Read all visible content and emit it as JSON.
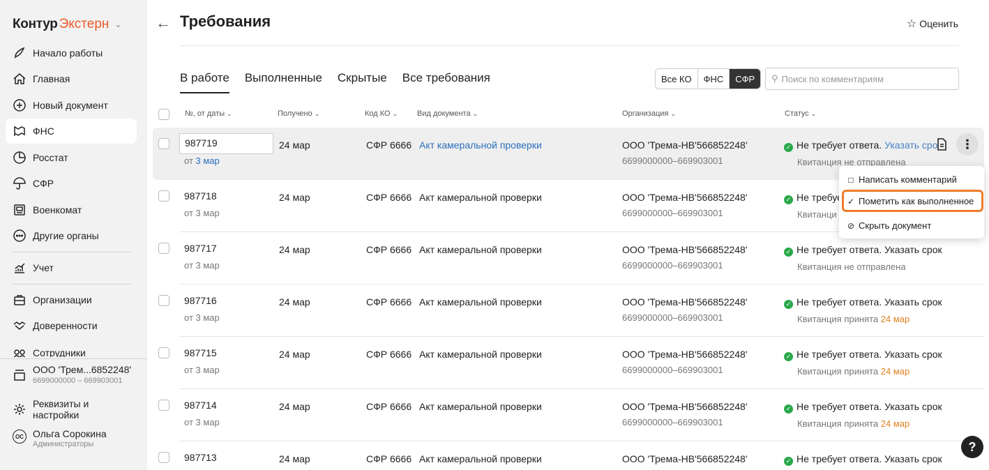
{
  "sidebar": {
    "brand": "Контур",
    "product": "Экстерн",
    "items": [
      {
        "label": "Начало работы",
        "icon": "rocket-icon"
      },
      {
        "label": "Главная",
        "icon": "home-icon"
      },
      {
        "label": "Новый документ",
        "icon": "plus-circle-icon"
      },
      {
        "label": "ФНС",
        "icon": "fns-icon"
      },
      {
        "label": "Росстат",
        "icon": "pie-chart-icon"
      },
      {
        "label": "СФР",
        "icon": "umbrella-icon"
      },
      {
        "label": "Военкомат",
        "icon": "military-icon"
      },
      {
        "label": "Другие органы",
        "icon": "more-circle-icon"
      },
      {
        "label": "Учет",
        "icon": "chart-growth-icon"
      },
      {
        "label": "Организации",
        "icon": "briefcase-icon"
      },
      {
        "label": "Доверенности",
        "icon": "handshake-icon"
      },
      {
        "label": "Сотрудники",
        "icon": "people-icon"
      }
    ],
    "org": {
      "name": "ООО 'Трем...6852248'",
      "inn": "6699000000 – 669903001"
    },
    "settings": "Реквизиты и настройки",
    "user": {
      "initials": "ОС",
      "name": "Ольга Сорокина",
      "role": "Администраторы"
    }
  },
  "header": {
    "title": "Требования",
    "rate": "Оценить"
  },
  "tabs": [
    "В работе",
    "Выполненные",
    "Скрытые",
    "Все требования"
  ],
  "filter": [
    "Все КО",
    "ФНС",
    "СФР"
  ],
  "search": {
    "placeholder": "Поиск по комментариям"
  },
  "columns": {
    "num": "№, от даты",
    "received": "Получено",
    "ko": "Код КО",
    "doctype": "Вид документа",
    "org": "Организация",
    "status": "Статус"
  },
  "rows": [
    {
      "num": "987719",
      "from_prefix": "от",
      "from_date": "3 мар",
      "received": "24 мар",
      "ko": "СФР 6666",
      "doctype": "Акт камеральной проверки",
      "org": "ООО 'Трема-НВ'566852248'",
      "inn": "6699000000–669903001",
      "status": "Не требует ответа.",
      "action": "Указать срок",
      "receipt": "Квитанция не отправлена",
      "receipt_date": ""
    },
    {
      "num": "987718",
      "from_prefix": "от",
      "from_date": "3 мар",
      "received": "24 мар",
      "ko": "СФР 6666",
      "doctype": "Акт камеральной проверки",
      "org": "ООО 'Трема-НВ'566852248'",
      "inn": "6699000000–669903001",
      "status": "Не требуе",
      "action": "",
      "receipt": "Квитанци",
      "receipt_date": ""
    },
    {
      "num": "987717",
      "from_prefix": "от",
      "from_date": "3 мар",
      "received": "24 мар",
      "ko": "СФР 6666",
      "doctype": "Акт камеральной проверки",
      "org": "ООО 'Трема-НВ'566852248'",
      "inn": "6699000000–669903001",
      "status": "Не требует ответа.",
      "action": "Указать срок",
      "receipt": "Квитанция не отправлена",
      "receipt_date": ""
    },
    {
      "num": "987716",
      "from_prefix": "от",
      "from_date": "3 мар",
      "received": "24 мар",
      "ko": "СФР 6666",
      "doctype": "Акт камеральной проверки",
      "org": "ООО 'Трема-НВ'566852248'",
      "inn": "6699000000–669903001",
      "status": "Не требует ответа.",
      "action": "Указать срок",
      "receipt": "Квитанция принята",
      "receipt_date": "24 мар"
    },
    {
      "num": "987715",
      "from_prefix": "от",
      "from_date": "3 мар",
      "received": "24 мар",
      "ko": "СФР 6666",
      "doctype": "Акт камеральной проверки",
      "org": "ООО 'Трема-НВ'566852248'",
      "inn": "6699000000–669903001",
      "status": "Не требует ответа.",
      "action": "Указать срок",
      "receipt": "Квитанция принята",
      "receipt_date": "24 мар"
    },
    {
      "num": "987714",
      "from_prefix": "от",
      "from_date": "3 мар",
      "received": "24 мар",
      "ko": "СФР 6666",
      "doctype": "Акт камеральной проверки",
      "org": "ООО 'Трема-НВ'566852248'",
      "inn": "6699000000–669903001",
      "status": "Не требует ответа.",
      "action": "Указать срок",
      "receipt": "Квитанция принята",
      "receipt_date": "24 мар"
    },
    {
      "num": "987713",
      "from_prefix": "",
      "from_date": "",
      "received": "24 мар",
      "ko": "СФР 6666",
      "doctype": "Акт камеральной проверки",
      "org": "ООО 'Трема-НВ'566852248'",
      "inn": "",
      "status": "Не требует ответа.",
      "action": "Указать срок",
      "receipt": "",
      "receipt_date": ""
    }
  ],
  "row0_action_short": "Указать сро",
  "menu": {
    "comment": "Написать комментарий",
    "mark_done": "Пометить как выполненное",
    "hide": "Скрыть документ"
  },
  "help": "?",
  "colors": {
    "accent": "#ee5a29",
    "link": "#2a6ebb",
    "ok": "#2aa84a",
    "highlight": "#f07c2a"
  }
}
